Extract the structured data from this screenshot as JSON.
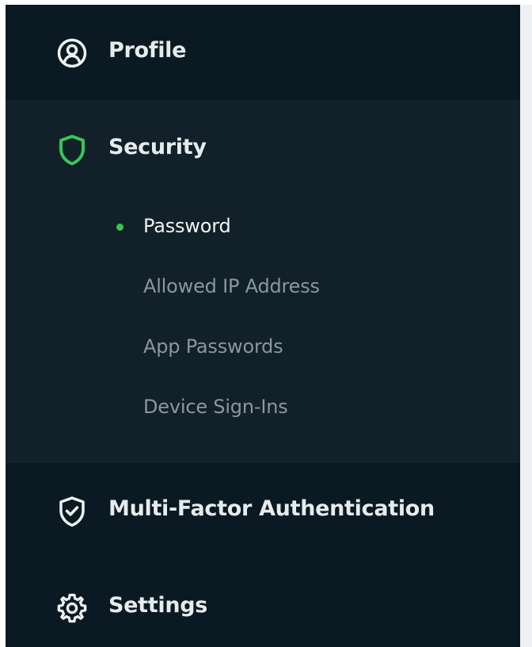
{
  "colors": {
    "sidebar_bg": "#0b1922",
    "section_bg": "#112029",
    "accent_green": "#35c94f",
    "text_primary": "#e6ebee",
    "text_muted": "#8b979f"
  },
  "sidebar": {
    "items": [
      {
        "label": "Profile",
        "icon": "user-circle-icon"
      },
      {
        "label": "Security",
        "icon": "shield-icon",
        "active": true,
        "sub_items": [
          {
            "label": "Password",
            "active": true
          },
          {
            "label": "Allowed IP Address"
          },
          {
            "label": "App Passwords"
          },
          {
            "label": "Device Sign-Ins"
          }
        ]
      },
      {
        "label": "Multi-Factor Authentication",
        "icon": "shield-check-icon"
      },
      {
        "label": "Settings",
        "icon": "gear-icon"
      }
    ]
  }
}
